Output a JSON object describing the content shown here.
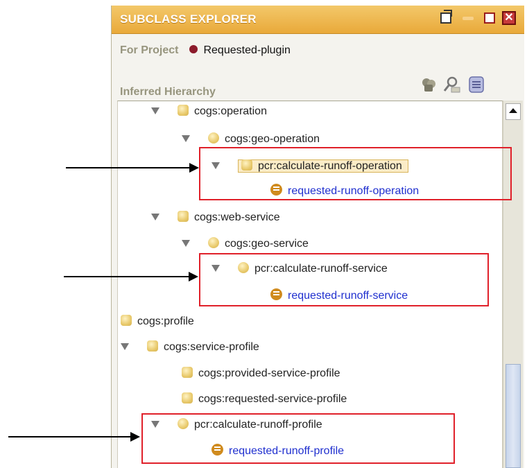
{
  "window": {
    "title": "SUBCLASS EXPLORER",
    "close_glyph": "✕"
  },
  "project": {
    "label": "For Project",
    "name": "Requested-plugin",
    "dot_color": "#8c1b2b"
  },
  "hierarchy": {
    "label": "Inferred Hierarchy",
    "toolbar_icons": [
      "lock-icon",
      "find-icon",
      "page-icon"
    ]
  },
  "tree": {
    "nodes": [
      {
        "label": "cogs:operation",
        "kind": "class"
      },
      {
        "label": "cogs:geo-operation",
        "kind": "class"
      },
      {
        "label": "pcr:calculate-runoff-operation",
        "kind": "class",
        "selected": true
      },
      {
        "label": "requested-runoff-operation",
        "kind": "instance"
      },
      {
        "label": "cogs:web-service",
        "kind": "class"
      },
      {
        "label": "cogs:geo-service",
        "kind": "class"
      },
      {
        "label": "pcr:calculate-runoff-service",
        "kind": "class"
      },
      {
        "label": "requested-runoff-service",
        "kind": "instance"
      },
      {
        "label": "cogs:profile",
        "kind": "class"
      },
      {
        "label": "cogs:service-profile",
        "kind": "class"
      },
      {
        "label": "cogs:provided-service-profile",
        "kind": "class"
      },
      {
        "label": "cogs:requested-service-profile",
        "kind": "class"
      },
      {
        "label": "pcr:calculate-runoff-profile",
        "kind": "class"
      },
      {
        "label": "requested-runoff-profile",
        "kind": "instance"
      }
    ]
  },
  "colors": {
    "title_bar": "#eeb550",
    "highlight": "#e0202a",
    "instance_text": "#1f2fcf"
  }
}
